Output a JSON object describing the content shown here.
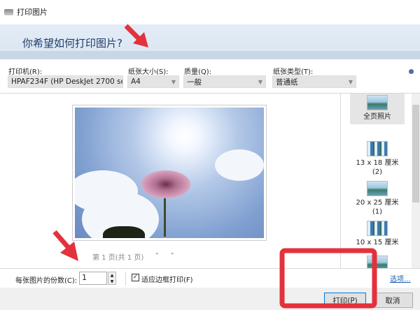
{
  "window": {
    "title": "打印图片"
  },
  "header": {
    "question": "你希望如何打印图片?"
  },
  "options": {
    "printer": {
      "label": "打印机(R):",
      "value": "HPAF234F (HP DeskJet 2700 se"
    },
    "paper_size": {
      "label": "纸张大小(S):",
      "value": "A4"
    },
    "quality": {
      "label": "质量(Q):",
      "value": "一般"
    },
    "paper_type": {
      "label": "纸张类型(T):",
      "value": "普通纸"
    },
    "help_icon": "help-icon"
  },
  "preview": {
    "page_text": "第 1 页(共 1 页)"
  },
  "layouts": [
    {
      "label": "全页照片",
      "selected": true
    },
    {
      "label": "13 x 18 厘米",
      "sub": "(2)"
    },
    {
      "label": "20 x 25 厘米",
      "sub": "(1)"
    },
    {
      "label": "10 x 15 厘米"
    }
  ],
  "bottom": {
    "copies_label": "每张图片的份数(C):",
    "copies_value": "1",
    "fit_label": "适应边框打印(F)",
    "fit_checked": true,
    "options_link": "选项..."
  },
  "footer": {
    "print": "打印(P)",
    "cancel": "取消"
  },
  "colors": {
    "annotation": "#e2323c",
    "header_bg": "#dbe6f2",
    "link": "#1a5fb4"
  }
}
